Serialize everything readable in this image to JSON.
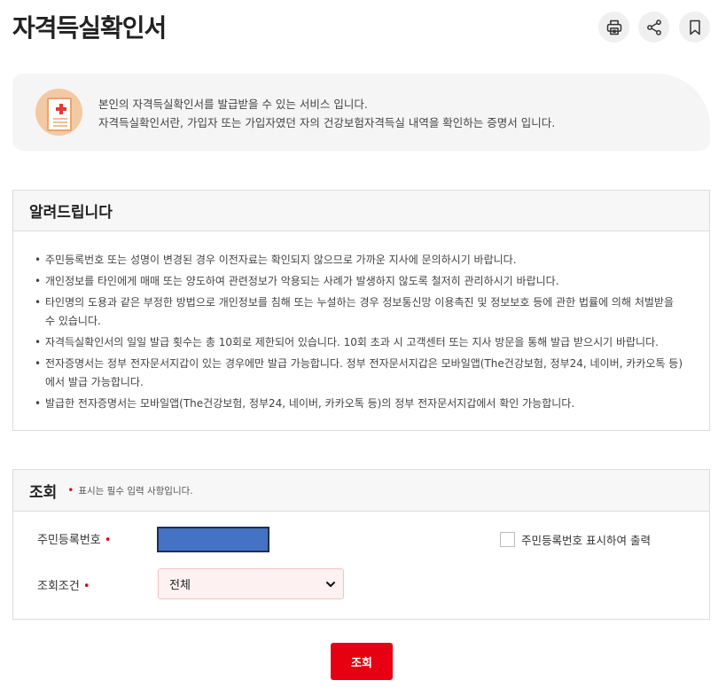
{
  "page": {
    "title": "자격득실확인서"
  },
  "toolbar": {
    "print_icon": "printer-icon",
    "share_icon": "share-icon",
    "bookmark_icon": "bookmark-icon"
  },
  "intro": {
    "icon": "medical-document-icon",
    "line1": "본인의 자격득실확인서를 발급받을 수 있는 서비스 입니다.",
    "line2": "자격득실확인서란, 가입자 또는 가입자였던 자의 건강보험자격득실 내역을 확인하는 증명서 입니다."
  },
  "notice": {
    "title": "알려드립니다",
    "items": [
      "주민등록번호 또는 성명이 변경된 경우 이전자료는 확인되지 않으므로 가까운 지사에 문의하시기 바랍니다.",
      "개인정보를 타인에게 매매 또는 양도하여 관련정보가 악용되는 사례가 발생하지 않도록 철저히 관리하시기 바랍니다.",
      "타인명의 도용과 같은 부정한 방법으로 개인정보를 침해 또는 누설하는 경우 정보통신망 이용촉진 및 정보보호 등에 관한 법률에 의해 처벌받을 수 있습니다.",
      "자격득실확인서의 일일 발급 횟수는 총 10회로 제한되어 있습니다. 10회 초과 시 고객센터 또는 지사 방문을 통해 발급 받으시기 바랍니다.",
      "전자증명서는 정부 전자문서지갑이 있는 경우에만 발급 가능합니다. 정부 전자문서지갑은 모바일앱(The건강보험, 정부24, 네이버, 카카오톡 등)에서 발급 가능합니다.",
      "발급한 전자증명서는 모바일앱(The건강보험, 정부24, 네이버, 카카오톡 등)의 정부 전자문서지갑에서 확인 가능합니다."
    ]
  },
  "search": {
    "title": "조회",
    "required_mark": "•",
    "required_note": "표시는 필수 입력 사항입니다.",
    "jumin_label": "주민등록번호",
    "show_jumin_label": "주민등록번호 표시하여 출력",
    "condition_label": "조회조건",
    "condition_value": "전체",
    "submit_label": "조회"
  },
  "colors": {
    "accent": "#e60012",
    "input_fill": "#4472c4",
    "select_bg": "#fdf1f1"
  }
}
